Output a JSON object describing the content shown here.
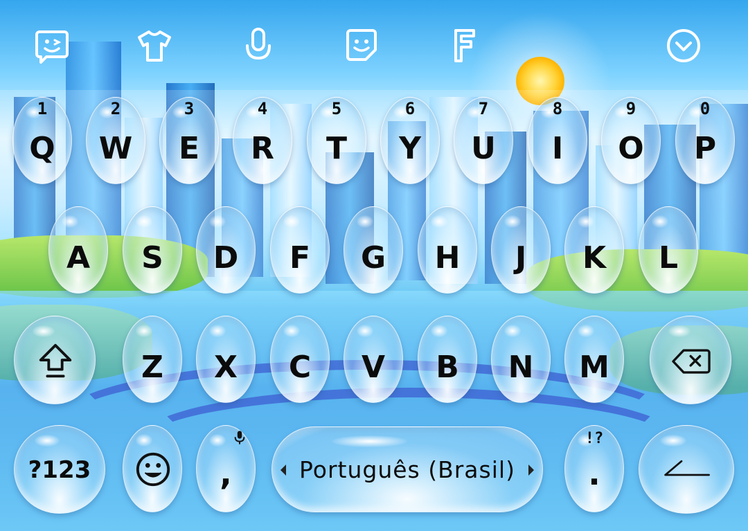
{
  "toolbar": {
    "icons": [
      "sticker-icon",
      "theme-shirt-icon",
      "microphone-icon",
      "emoji-face-icon",
      "font-icon",
      "collapse-chevron-icon"
    ]
  },
  "keyboard": {
    "row1": [
      {
        "label": "Q",
        "hint": "1"
      },
      {
        "label": "W",
        "hint": "2"
      },
      {
        "label": "E",
        "hint": "3"
      },
      {
        "label": "R",
        "hint": "4"
      },
      {
        "label": "T",
        "hint": "5"
      },
      {
        "label": "Y",
        "hint": "6"
      },
      {
        "label": "U",
        "hint": "7"
      },
      {
        "label": "I",
        "hint": "8"
      },
      {
        "label": "O",
        "hint": "9"
      },
      {
        "label": "P",
        "hint": "0"
      }
    ],
    "row2": [
      "A",
      "S",
      "D",
      "F",
      "G",
      "H",
      "J",
      "K",
      "L"
    ],
    "row3": [
      "Z",
      "X",
      "C",
      "V",
      "B",
      "N",
      "M"
    ],
    "bottom": {
      "symbols_label": "?123",
      "comma_label": ",",
      "space_label": "Português (Brasil)",
      "period_label": ".",
      "period_hint": "!?"
    }
  },
  "colors": {
    "key_text": "#0b0b0b",
    "icon_stroke": "#ffffff"
  }
}
